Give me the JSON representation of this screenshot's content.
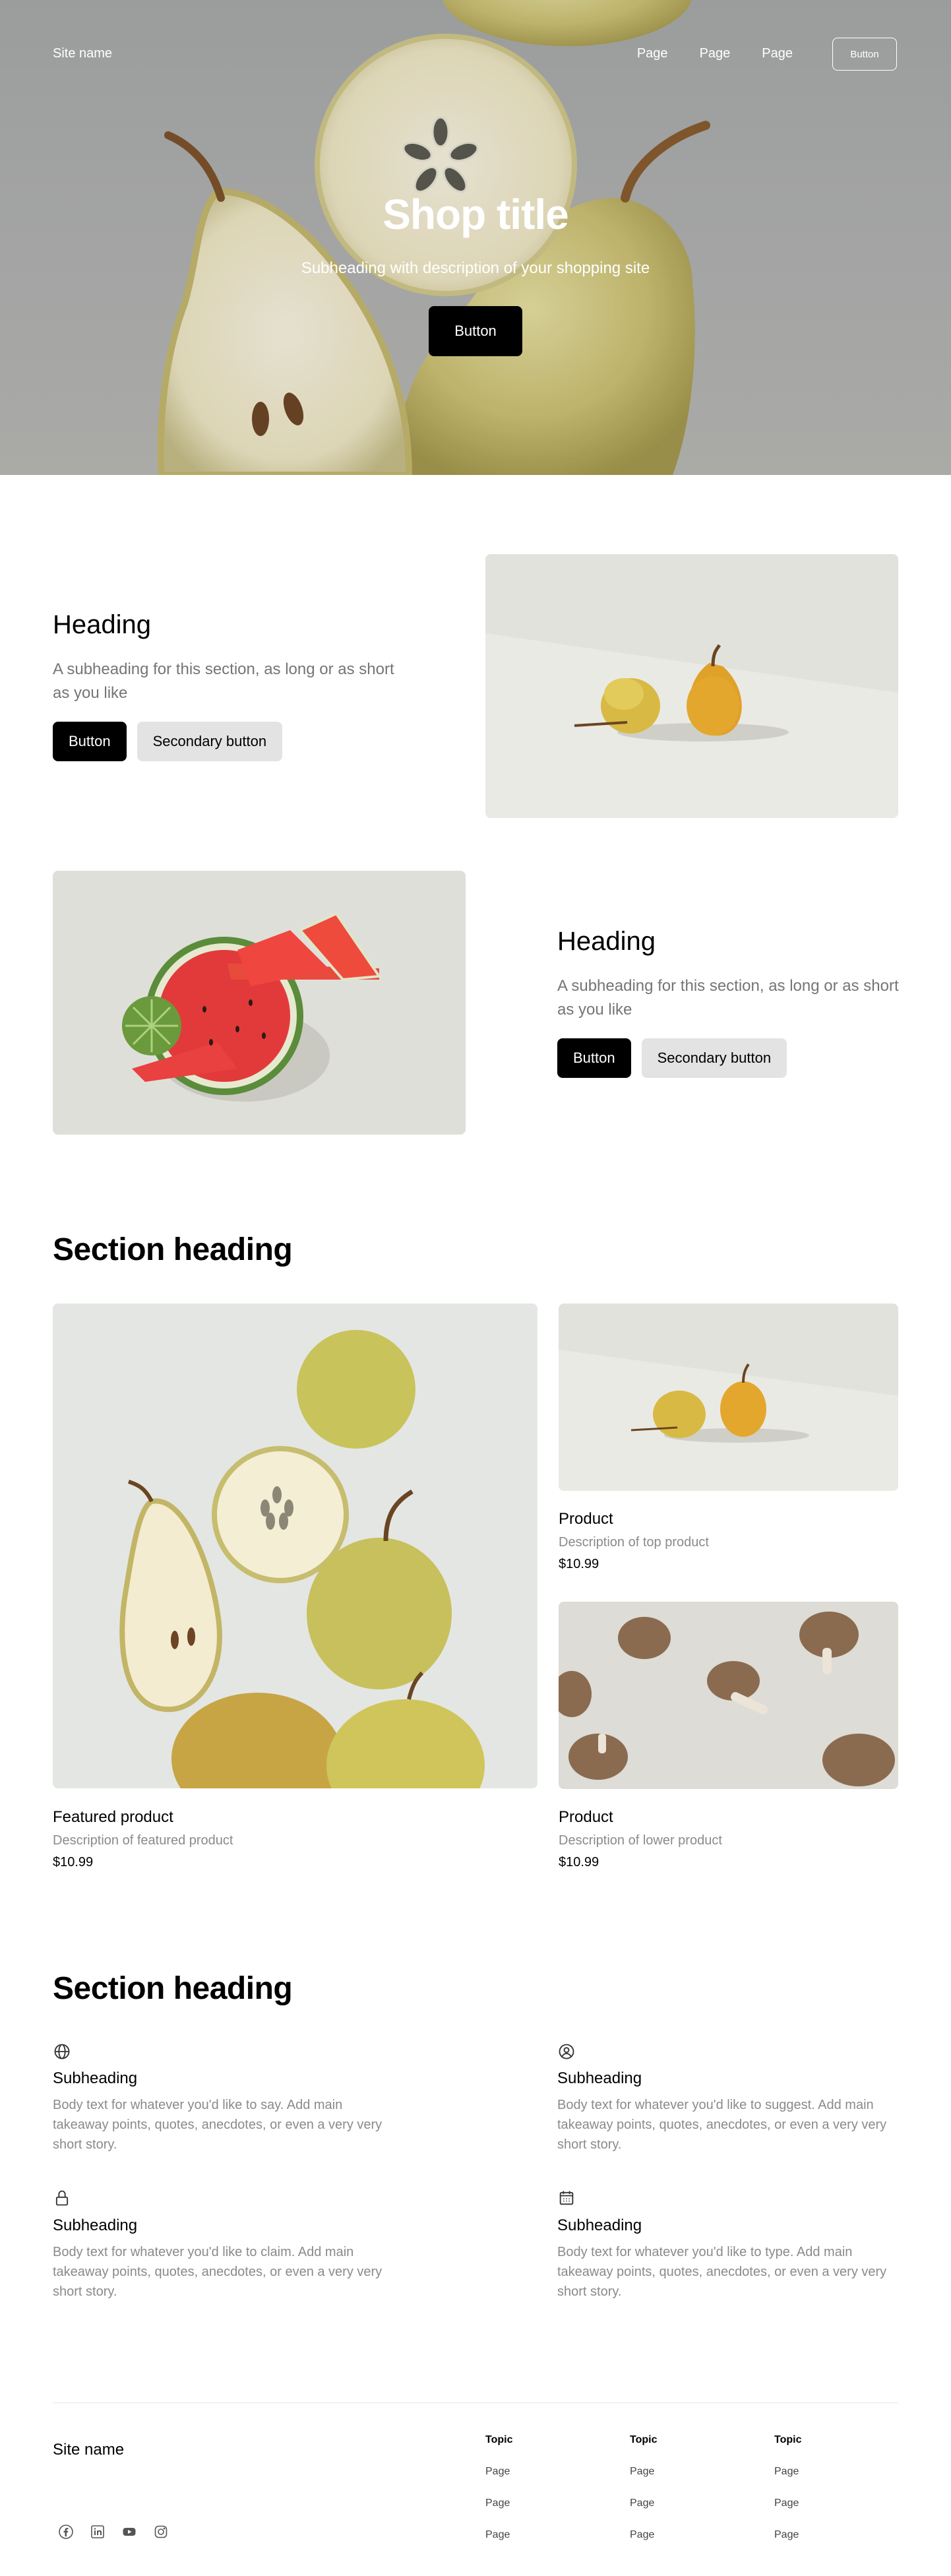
{
  "nav": {
    "site_name": "Site name",
    "links": [
      "Page",
      "Page",
      "Page"
    ],
    "button_label": "Button"
  },
  "hero": {
    "title": "Shop title",
    "subtitle": "Subheading with description of your shopping site",
    "button_label": "Button"
  },
  "section_a": {
    "heading": "Heading",
    "subheading": "A subheading for this section, as long or as short as you like",
    "primary_label": "Button",
    "secondary_label": "Secondary button"
  },
  "section_b": {
    "heading": "Heading",
    "subheading": "A subheading for this section, as long or as short as you like",
    "primary_label": "Button",
    "secondary_label": "Secondary button"
  },
  "products": {
    "heading": "Section heading",
    "featured": {
      "title": "Featured product",
      "description": "Description of featured product",
      "price": "$10.99"
    },
    "top": {
      "title": "Product",
      "description": "Description of top product",
      "price": "$10.99"
    },
    "lower": {
      "title": "Product",
      "description": "Description of lower product",
      "price": "$10.99"
    }
  },
  "features": {
    "heading": "Section heading",
    "items": [
      {
        "icon": "globe-icon",
        "title": "Subheading",
        "body": "Body text for whatever you'd like to say. Add main takeaway points, quotes, anecdotes, or even a very very short story."
      },
      {
        "icon": "user-circle-icon",
        "title": "Subheading",
        "body": "Body text for whatever you'd like to suggest. Add main takeaway points, quotes, anecdotes, or even a very very short story."
      },
      {
        "icon": "lock-icon",
        "title": "Subheading",
        "body": "Body text for whatever you'd like to claim. Add main takeaway points, quotes, anecdotes, or even a very very short story."
      },
      {
        "icon": "calendar-icon",
        "title": "Subheading",
        "body": "Body text for whatever you'd like to type. Add main takeaway points, quotes, anecdotes, or even a very very short story."
      }
    ]
  },
  "footer": {
    "site_name": "Site name",
    "columns": [
      {
        "topic": "Topic",
        "pages": [
          "Page",
          "Page",
          "Page"
        ]
      },
      {
        "topic": "Topic",
        "pages": [
          "Page",
          "Page",
          "Page"
        ]
      },
      {
        "topic": "Topic",
        "pages": [
          "Page",
          "Page",
          "Page"
        ]
      }
    ],
    "social_icons": [
      "facebook-icon",
      "linkedin-icon",
      "youtube-icon",
      "instagram-icon"
    ]
  }
}
